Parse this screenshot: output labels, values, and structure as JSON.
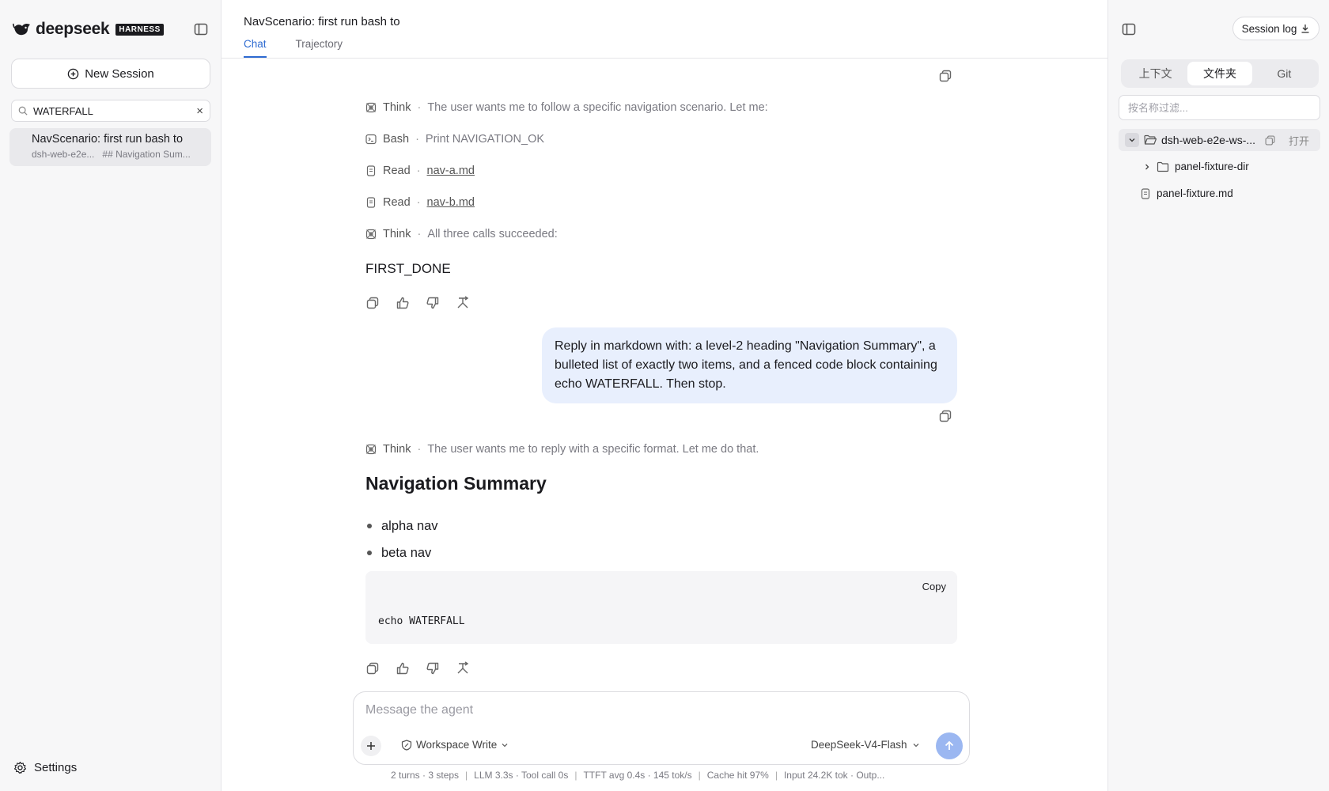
{
  "sidebar": {
    "brand": "deepseek",
    "brand_badge": "HARNESS",
    "new_session_label": "New Session",
    "search_value": "WATERFALL",
    "search_clear": "×",
    "sessions": [
      {
        "title": "NavScenario: first run bash to",
        "workspace": "dsh-web-e2e...",
        "snippet": "## Navigation Sum..."
      }
    ],
    "settings_label": "Settings"
  },
  "header": {
    "title": "NavScenario: first run bash to",
    "tabs": [
      "Chat",
      "Trajectory"
    ],
    "active_tab": "Chat"
  },
  "chat": {
    "turn1": {
      "tools": [
        {
          "icon": "think-icon",
          "name": "Think",
          "desc": "The user wants me to follow a specific navigation scenario. Let me:"
        },
        {
          "icon": "terminal-icon",
          "name": "Bash",
          "desc": "Print NAVIGATION_OK"
        },
        {
          "icon": "file-icon",
          "name": "Read",
          "link": "nav-a.md"
        },
        {
          "icon": "file-icon",
          "name": "Read",
          "link": "nav-b.md"
        },
        {
          "icon": "think-icon",
          "name": "Think",
          "desc": "All three calls succeeded:"
        }
      ],
      "answer": "FIRST_DONE"
    },
    "user_message": "Reply in markdown with: a level-2 heading \"Navigation Summary\", a bulleted list of exactly two items, and a fenced code block containing echo WATERFALL. Then stop.",
    "turn2": {
      "think": {
        "name": "Think",
        "desc": "The user wants me to reply with a specific format. Let me do that."
      },
      "heading": "Navigation Summary",
      "bullets": [
        "alpha nav",
        "beta nav"
      ],
      "code_copy_label": "Copy",
      "code": "echo WATERFALL"
    },
    "separator": "·"
  },
  "composer": {
    "placeholder": "Message the agent",
    "mode": "Workspace Write",
    "model": "DeepSeek-V4-Flash"
  },
  "stats": [
    "2 turns · 3 steps",
    "LLM 3.3s · Tool call 0s",
    "TTFT avg 0.4s · 145 tok/s",
    "Cache hit 97%",
    "Input 24.2K tok · Outp..."
  ],
  "stats_sep": "|",
  "right_panel": {
    "session_log_label": "Session log",
    "segments": [
      "上下文",
      "文件夹",
      "Git"
    ],
    "active_segment": "文件夹",
    "filter_placeholder": "按名称过滤...",
    "root_folder": "dsh-web-e2e-ws-...",
    "open_label": "打开",
    "children": [
      {
        "type": "folder",
        "name": "panel-fixture-dir"
      },
      {
        "type": "file",
        "name": "panel-fixture.md"
      }
    ]
  },
  "colors": {
    "accent": "#2e6bd1",
    "user_bubble": "#e8effd",
    "send_button": "#9bb7f1",
    "sidebar_bg": "#f7f7f8"
  }
}
